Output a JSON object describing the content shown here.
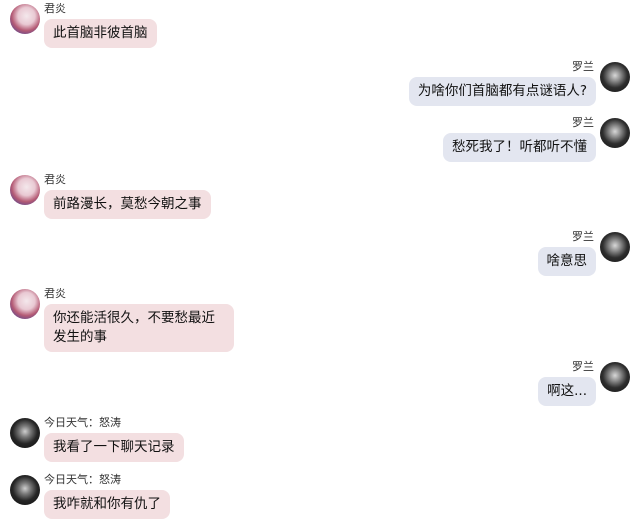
{
  "users": {
    "junyan": "君炎",
    "luolan": "罗兰",
    "jinri": "今日天气：怒涛"
  },
  "messages": [
    {
      "sender": "君炎",
      "text": "此首脑非彼首脑"
    },
    {
      "sender": "罗兰",
      "text": "为啥你们首脑都有点谜语人?"
    },
    {
      "sender": "罗兰",
      "text": "愁死我了！听都听不懂"
    },
    {
      "sender": "君炎",
      "text": "前路漫长，莫愁今朝之事"
    },
    {
      "sender": "罗兰",
      "text": "啥意思"
    },
    {
      "sender": "君炎",
      "text": "你还能活很久，不要愁最近发生的事"
    },
    {
      "sender": "罗兰",
      "text": "啊这..."
    },
    {
      "sender": "今日天气：怒涛",
      "text": "我看了一下聊天记录"
    },
    {
      "sender": "今日天气：怒涛",
      "text": "我咋就和你有仇了"
    }
  ],
  "icons": {
    "junyan_avatar": "avatar-icon",
    "luolan_avatar": "avatar-icon",
    "jinri_avatar": "avatar-icon"
  },
  "colors": {
    "left_bubble": "#f3dfe1",
    "right_bubble": "#e3e6f0"
  }
}
